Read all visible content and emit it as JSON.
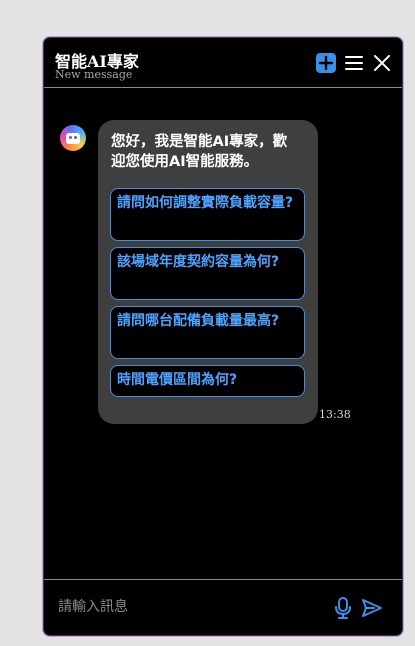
{
  "header": {
    "title": "智能AI專家",
    "subtitle": "New message",
    "icons": [
      "new-chat-icon",
      "menu-icon",
      "close-icon"
    ]
  },
  "messages": [
    {
      "sender": "bot",
      "avatar_icon": "robot-icon",
      "greeting_line1": "您好，我是智能AI專家，歡",
      "greeting_line2": "迎您使用AI智能服務。",
      "suggestions": [
        "請問如何調整實際負載容量?",
        "該場域年度契約容量為何?",
        "請問哪台配備負載量最高?",
        "時間電價區間為何?"
      ],
      "time": "13:38"
    }
  ],
  "input": {
    "placeholder": "請輸入訊息",
    "value": ""
  },
  "colors": {
    "accent": "#3a8fe8",
    "suggestion_text": "#4ea3ff",
    "bubble_bg": "#3f3f3f",
    "window_bg": "#000000"
  }
}
